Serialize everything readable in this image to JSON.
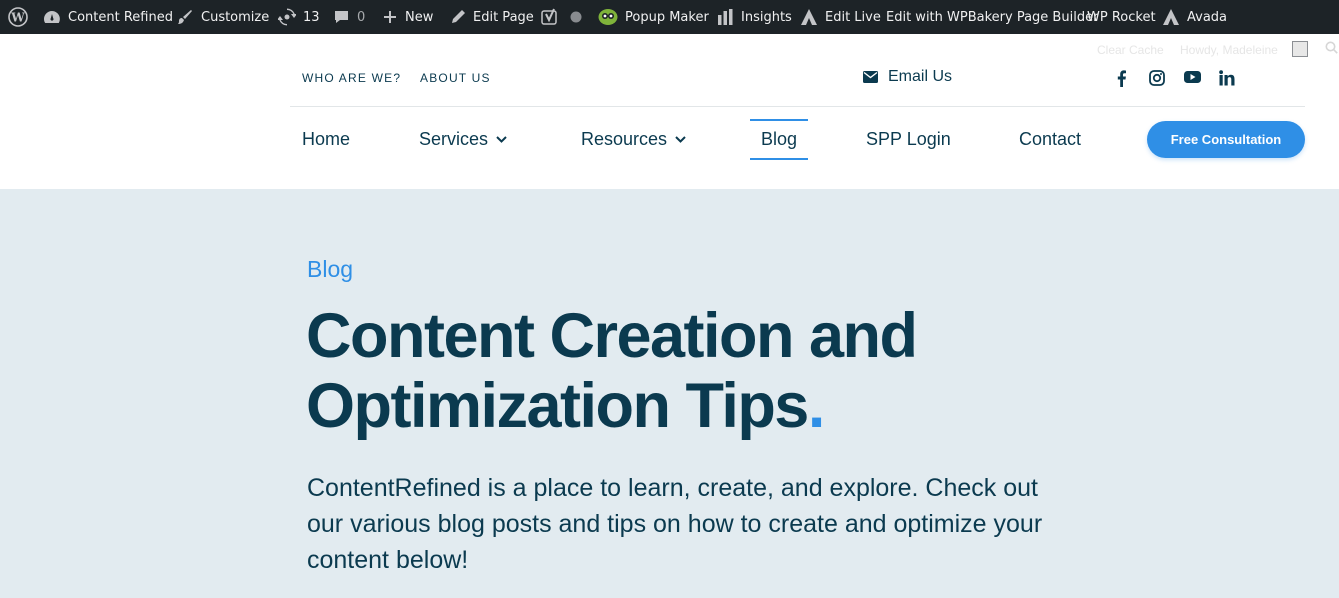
{
  "adminbar": {
    "site_name": "Content Refined",
    "customize": "Customize",
    "updates_count": "13",
    "comments_count": "0",
    "new": "New",
    "edit_page": "Edit Page",
    "popup_maker": "Popup Maker",
    "insights": "Insights",
    "edit_live": "Edit Live",
    "wpbakery": "Edit with WPBakery Page Builder",
    "wp_rocket": "WP Rocket",
    "avada": "Avada",
    "clear_cache": "Clear Cache",
    "howdy": "Howdy, Madeleine"
  },
  "header": {
    "top_links": [
      "WHO ARE WE?",
      "ABOUT US"
    ],
    "email_label": "Email Us",
    "social_icons": [
      "facebook-icon",
      "instagram-icon",
      "youtube-icon",
      "linkedin-icon"
    ],
    "nav": [
      "Home",
      "Services",
      "Resources",
      "Blog",
      "SPP Login",
      "Contact"
    ],
    "active_nav": "Blog",
    "cta": "Free Consultation"
  },
  "hero": {
    "eyebrow": "Blog",
    "headline": "Content Creation and Optimization Tips",
    "headline_end": ".",
    "lead": "ContentRefined is a place to learn, create, and explore. Check out our various blog posts and tips on how to create and optimize your content below!"
  },
  "colors": {
    "adminbar_bg": "#1d2327",
    "brand_navy": "#0b3a4f",
    "accent_blue": "#2f8fe6",
    "hero_bg": "#e2ebf0"
  }
}
